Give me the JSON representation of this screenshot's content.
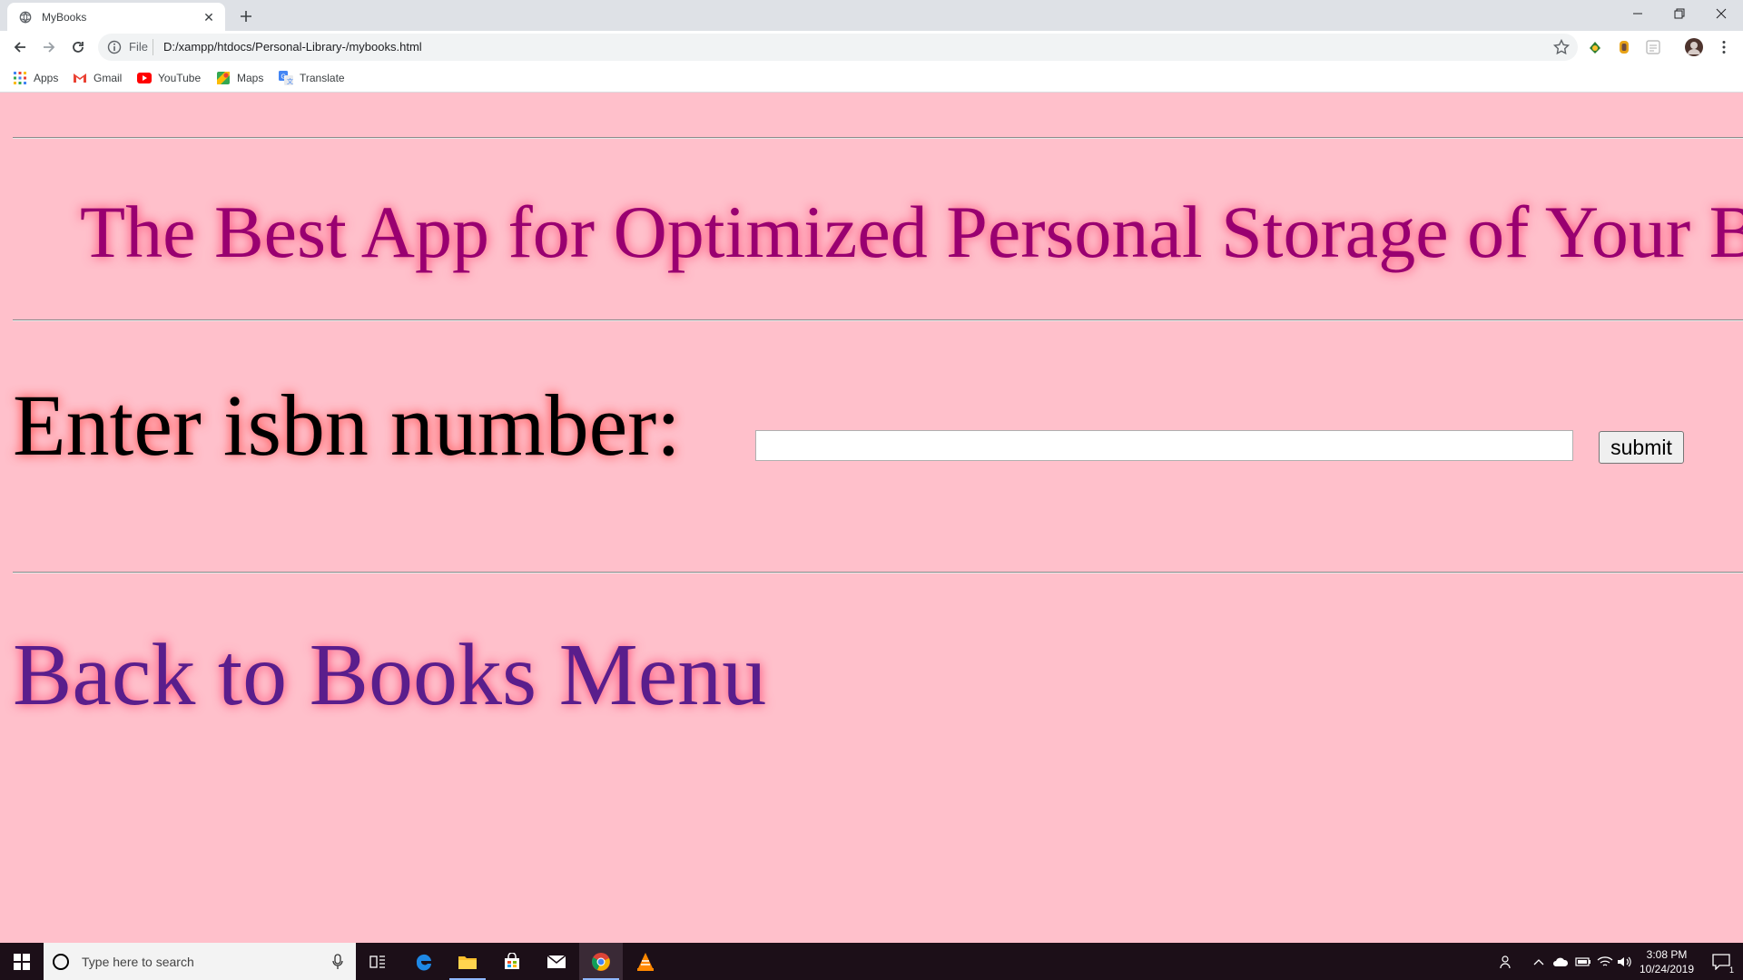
{
  "browser": {
    "tab_title": "MyBooks",
    "address_scheme": "File",
    "address_url": "D:/xampp/htdocs/Personal-Library-/mybooks.html",
    "bookmarks": [
      {
        "label": "Apps",
        "icon": "apps-grid-icon"
      },
      {
        "label": "Gmail",
        "icon": "gmail-icon"
      },
      {
        "label": "YouTube",
        "icon": "youtube-icon"
      },
      {
        "label": "Maps",
        "icon": "maps-icon"
      },
      {
        "label": "Translate",
        "icon": "translate-icon"
      }
    ]
  },
  "page": {
    "headline": "The Best App for Optimized Personal Storage of Your B",
    "isbn_label": "Enter isbn number:",
    "isbn_value": "",
    "submit_label": "submit",
    "back_link": "Back to Books Menu",
    "colors": {
      "background": "#ffc0cb",
      "headline": "#990070",
      "link": "#5a1e8c",
      "glow": "#ff3b6b"
    }
  },
  "taskbar": {
    "search_placeholder": "Type here to search",
    "time": "3:08 PM",
    "date": "10/24/2019",
    "notification_count": "1"
  }
}
